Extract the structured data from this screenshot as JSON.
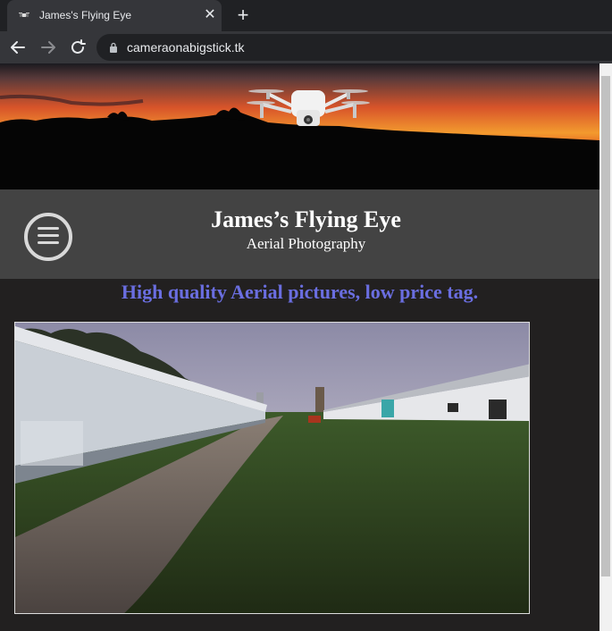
{
  "browser": {
    "tab": {
      "title": "James's Flying Eye",
      "close_glyph": "✕",
      "favicon": "drone-favicon-icon"
    },
    "new_tab_glyph": "+",
    "url": "cameraonabigstick.tk"
  },
  "site": {
    "title": "James’s Flying Eye",
    "subtitle": "Aerial Photography",
    "tagline": "High quality Aerial pictures, low price tag.",
    "tagline_color": "#6a6ee0",
    "header_bg": "#434343"
  }
}
